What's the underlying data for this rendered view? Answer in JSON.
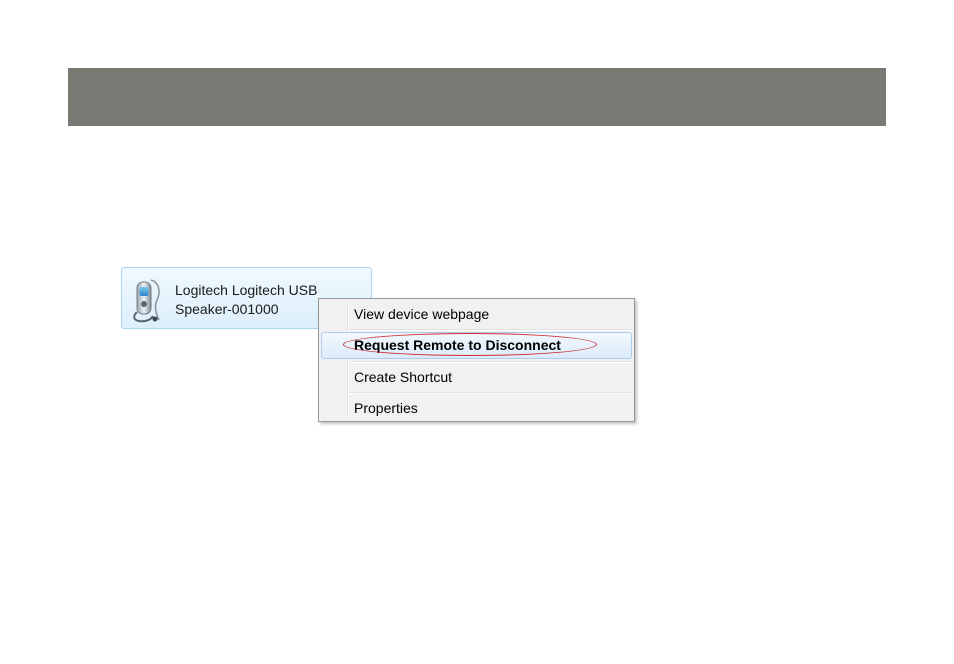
{
  "device": {
    "name": "Logitech Logitech USB\nSpeaker-001000",
    "icon": "bluetooth-speaker-icon"
  },
  "context_menu": {
    "items": [
      {
        "label": "View device webpage"
      },
      {
        "label": "Request Remote to Disconnect",
        "highlighted": true
      },
      {
        "label": "Create Shortcut"
      },
      {
        "label": "Properties"
      }
    ]
  },
  "colors": {
    "band": "#787a74",
    "highlight_ring": "#d0272f",
    "selection_border": "#aeccec"
  }
}
